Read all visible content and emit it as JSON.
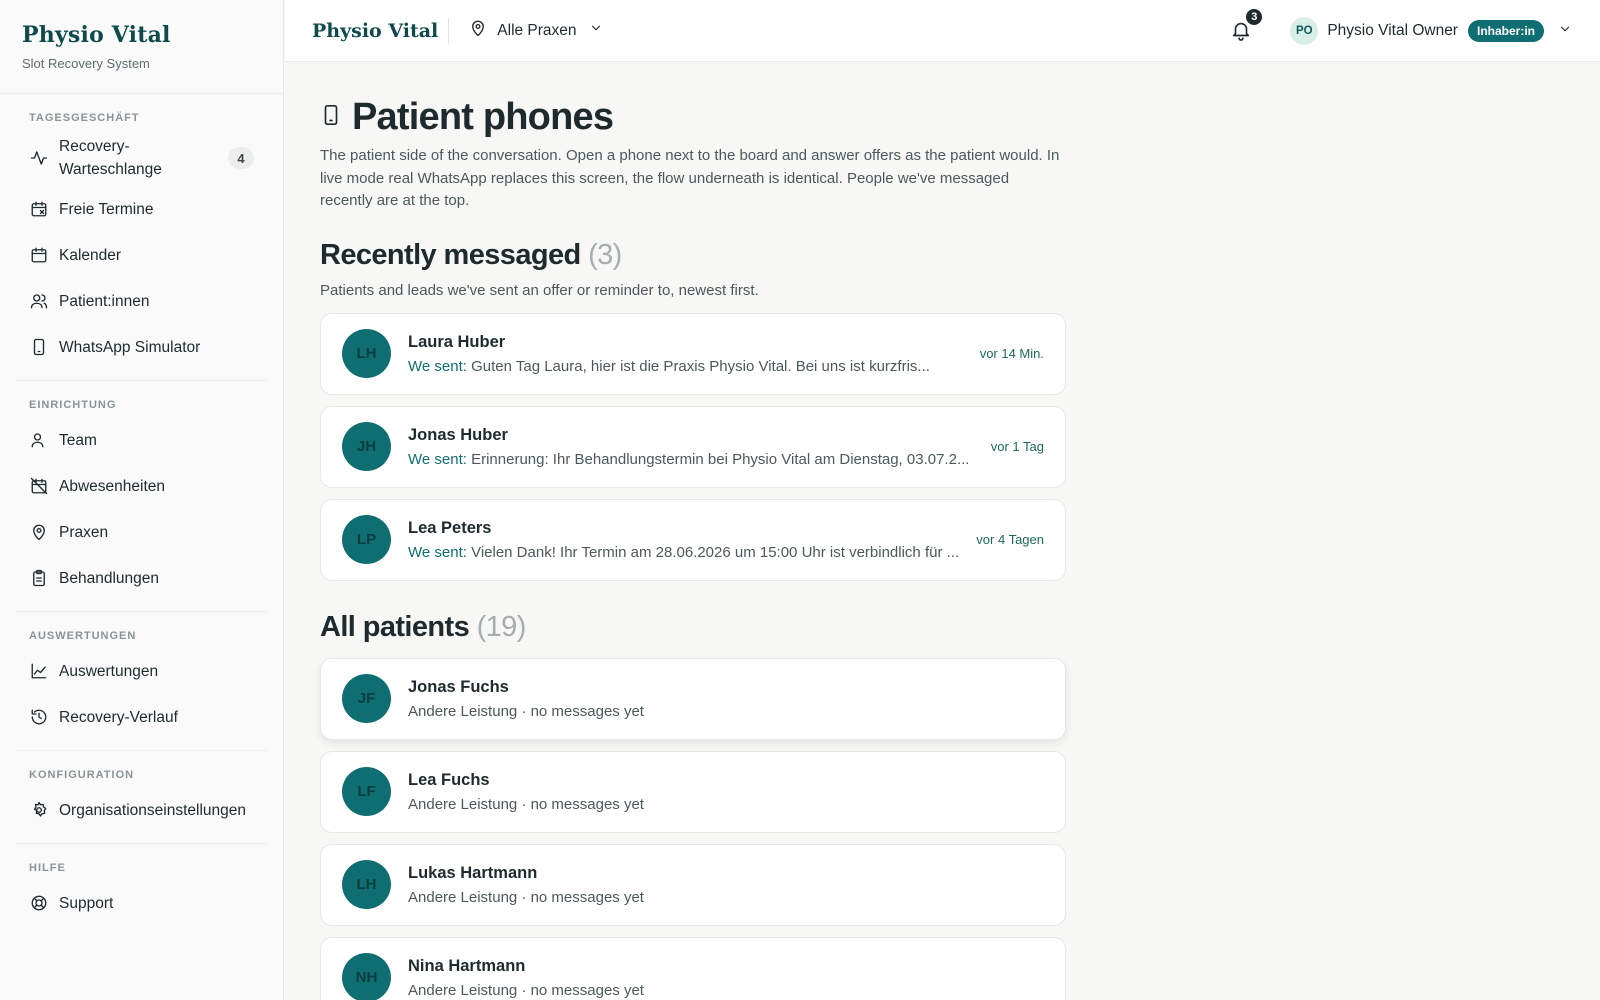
{
  "sidebar": {
    "brand": "Physio Vital",
    "subtitle": "Slot Recovery System",
    "sections": [
      {
        "heading": "TAGESGESCHÄFT"
      },
      {
        "heading": "EINRICHTUNG"
      },
      {
        "heading": "AUSWERTUNGEN"
      },
      {
        "heading": "KONFIGURATION"
      },
      {
        "heading": "HILFE"
      }
    ],
    "items": {
      "recovery": {
        "label": "Recovery-\nWarteschlange",
        "badge": "4",
        "icon": "activity-icon"
      },
      "freie": {
        "label": "Freie Termine",
        "icon": "calendar-x-icon"
      },
      "kalender": {
        "label": "Kalender",
        "icon": "calendar-icon"
      },
      "patienten": {
        "label": "Patient:innen",
        "icon": "users-icon"
      },
      "whatsapp": {
        "label": "WhatsApp Simulator",
        "icon": "smartphone-icon"
      },
      "team": {
        "label": "Team",
        "icon": "user-icon"
      },
      "abwesenheiten": {
        "label": "Abwesenheiten",
        "icon": "calendar-off-icon"
      },
      "praxen": {
        "label": "Praxen",
        "icon": "map-pin-icon"
      },
      "behandlungen": {
        "label": "Behandlungen",
        "icon": "clipboard-icon"
      },
      "auswertungen": {
        "label": "Auswertungen",
        "icon": "line-chart-icon"
      },
      "verlauf": {
        "label": "Recovery-Verlauf",
        "icon": "history-icon"
      },
      "org": {
        "label": "Organisationseinstellungen",
        "icon": "gear-icon"
      },
      "support": {
        "label": "Support",
        "icon": "life-buoy-icon"
      }
    }
  },
  "topbar": {
    "brand": "Physio Vital",
    "location": "Alle Praxen",
    "notifications": "3",
    "user_initials": "PO",
    "user_name": "Physio Vital Owner",
    "role": "Inhaber:in"
  },
  "page": {
    "title": "Patient phones",
    "description": "The patient side of the conversation. Open a phone next to the board and answer offers as the patient would. In live mode real WhatsApp replaces this screen, the flow underneath is identical. People we've messaged recently are at the top."
  },
  "recent": {
    "title": "Recently messaged",
    "count": "(3)",
    "description": "Patients and leads we've sent an offer or reminder to, newest first.",
    "prefix": "We sent:",
    "items": [
      {
        "initials": "LH",
        "name": "Laura Huber",
        "message": "Guten Tag Laura, hier ist die Praxis Physio Vital. Bei uns ist kurzfris...",
        "time": "vor 14 Min."
      },
      {
        "initials": "JH",
        "name": "Jonas Huber",
        "message": "Erinnerung: Ihr Behandlungstermin bei Physio Vital am Dienstag, 03.07.2...",
        "time": "vor 1 Tag"
      },
      {
        "initials": "LP",
        "name": "Lea Peters",
        "message": "Vielen Dank! Ihr Termin am 28.06.2026 um 15:00 Uhr ist verbindlich für ...",
        "time": "vor 4 Tagen"
      }
    ]
  },
  "all": {
    "title": "All patients",
    "count": "(19)",
    "items": [
      {
        "initials": "JF",
        "name": "Jonas Fuchs",
        "subtitle": "Andere Leistung · no messages yet"
      },
      {
        "initials": "LF",
        "name": "Lea Fuchs",
        "subtitle": "Andere Leistung · no messages yet"
      },
      {
        "initials": "LH",
        "name": "Lukas Hartmann",
        "subtitle": "Andere Leistung · no messages yet"
      },
      {
        "initials": "NH",
        "name": "Nina Hartmann",
        "subtitle": "Andere Leistung · no messages yet"
      }
    ]
  },
  "colors": {
    "brand": "#0f4a4d",
    "accent": "#0f6e71",
    "avatar_bg": "#0f6e71"
  }
}
